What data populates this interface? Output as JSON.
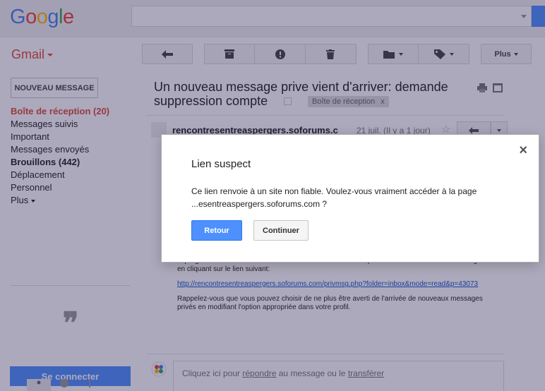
{
  "header": {
    "logo": "Google",
    "search_value": ""
  },
  "gmail_label": "Gmail",
  "toolbar": {
    "more_label": "Plus"
  },
  "sidebar": {
    "compose_label": "NOUVEAU MESSAGE",
    "items": [
      {
        "label": "Boîte de réception (20)"
      },
      {
        "label": "Messages suivis"
      },
      {
        "label": "Important"
      },
      {
        "label": "Messages envoyés"
      },
      {
        "label": "Brouillons (442)"
      },
      {
        "label": "Déplacement"
      },
      {
        "label": "Personnel"
      },
      {
        "label": "Plus"
      }
    ],
    "signin_label": "Se connecter"
  },
  "message": {
    "subject": "Un nouveau message prive vient d'arriver: demande suppression compte",
    "label_chip": "Boîte de réception",
    "label_chip_close": "x",
    "sender": "rencontresentreaspergers.soforums.c",
    "date": "21 juil. (Il y a 1 jour)",
    "body_para1": "aspergers\" et avez demandé à être averti dans ce cas. Vous pouvez voir votre nouveau message en cliquant sur le lien suivant:",
    "body_link": "http://rencontresentreaspergers.soforums.com/privmsg.php?folder=inbox&mode=read&p=43073",
    "body_para2": "Rappelez-vous que vous pouvez choisir de ne plus être averti de l'arrivée de nouveaux messages privés en modifiant l'option appropriée dans votre profil.",
    "reply_prefix": "Cliquez ici pour ",
    "reply_link": "répondre",
    "reply_middle": " au message ou le ",
    "forward_link": "transférer"
  },
  "dialog": {
    "title": "Lien suspect",
    "text_line1": "Ce lien renvoie à un site non fiable. Voulez-vous vraiment accéder à la page",
    "text_line2": "...esentreaspergers.soforums.com ?",
    "back_label": "Retour",
    "continue_label": "Continuer",
    "close_label": "×"
  },
  "colors": {
    "accent_blue": "#4d90fe",
    "gmail_red": "#dd4b39",
    "overlay": "rgba(40,30,80,0.38)"
  }
}
